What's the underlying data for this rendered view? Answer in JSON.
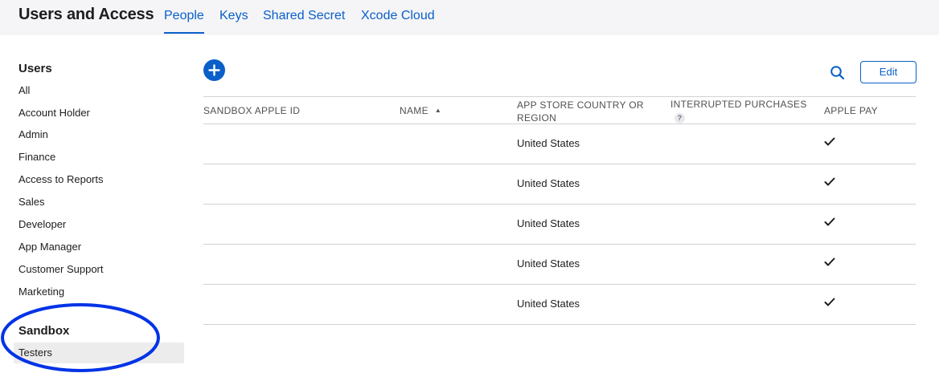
{
  "header": {
    "title": "Users and Access",
    "tabs": [
      {
        "label": "People",
        "active": true
      },
      {
        "label": "Keys",
        "active": false
      },
      {
        "label": "Shared Secret",
        "active": false
      },
      {
        "label": "Xcode Cloud",
        "active": false
      }
    ]
  },
  "sidebar": {
    "users_heading": "Users",
    "users_items": [
      "All",
      "Account Holder",
      "Admin",
      "Finance",
      "Access to Reports",
      "Sales",
      "Developer",
      "App Manager",
      "Customer Support",
      "Marketing"
    ],
    "sandbox_heading": "Sandbox",
    "sandbox_items": [
      "Testers"
    ],
    "selected_item": "Testers",
    "annotation_color": "#0033e6"
  },
  "toolbar": {
    "add_icon": "plus-circle-icon",
    "search_icon": "search-icon",
    "edit_label": "Edit"
  },
  "table": {
    "columns": [
      {
        "label": "SANDBOX APPLE ID"
      },
      {
        "label": "NAME",
        "sort_indicator": "ascending"
      },
      {
        "label": "APP STORE COUNTRY OR REGION"
      },
      {
        "label": "INTERRUPTED PURCHASES",
        "help": "?"
      },
      {
        "label": "APPLE PAY"
      }
    ],
    "rows": [
      {
        "sandbox_apple_id": "",
        "name": "",
        "country": "United States",
        "interrupted_purchases": "",
        "apple_pay": true
      },
      {
        "sandbox_apple_id": "",
        "name": "",
        "country": "United States",
        "interrupted_purchases": "",
        "apple_pay": true
      },
      {
        "sandbox_apple_id": "",
        "name": "",
        "country": "United States",
        "interrupted_purchases": "",
        "apple_pay": true
      },
      {
        "sandbox_apple_id": "",
        "name": "",
        "country": "United States",
        "interrupted_purchases": "",
        "apple_pay": true
      },
      {
        "sandbox_apple_id": "",
        "name": "",
        "country": "United States",
        "interrupted_purchases": "",
        "apple_pay": true
      }
    ]
  },
  "colors": {
    "accent": "#0a5fc9",
    "divider": "#d2d2d7",
    "topbar_bg": "#f5f5f7",
    "selected_bg": "#ececec"
  }
}
